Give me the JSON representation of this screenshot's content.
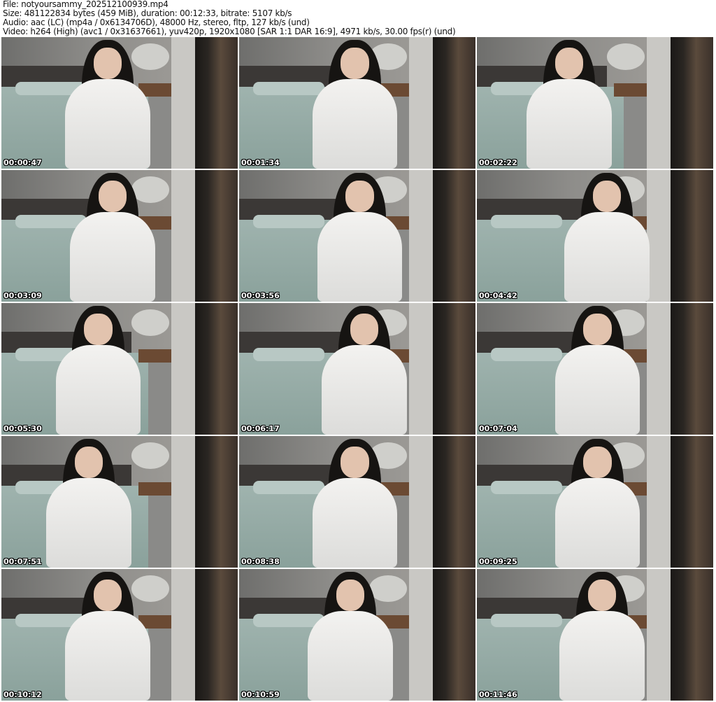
{
  "header": {
    "file": "File: notyoursammy_202512100939.mp4",
    "size": "Size: 481122834 bytes (459 MiB), duration: 00:12:33, bitrate: 5107 kb/s",
    "audio": "Audio: aac (LC) (mp4a / 0x6134706D), 48000 Hz, stereo, fltp, 127 kb/s (und)",
    "video": "Video: h264 (High) (avc1 / 0x31637661), yuv420p, 1920x1080 [SAR 1:1 DAR 16:9], 4971 kb/s, 30.00 fps(r) (und)"
  },
  "thumbnails": [
    {
      "timestamp": "00:00:47"
    },
    {
      "timestamp": "00:01:34"
    },
    {
      "timestamp": "00:02:22"
    },
    {
      "timestamp": "00:03:09"
    },
    {
      "timestamp": "00:03:56"
    },
    {
      "timestamp": "00:04:42"
    },
    {
      "timestamp": "00:05:30"
    },
    {
      "timestamp": "00:06:17"
    },
    {
      "timestamp": "00:07:04"
    },
    {
      "timestamp": "00:07:51"
    },
    {
      "timestamp": "00:08:38"
    },
    {
      "timestamp": "00:09:25"
    },
    {
      "timestamp": "00:10:12"
    },
    {
      "timestamp": "00:10:59"
    },
    {
      "timestamp": "00:11:46"
    }
  ]
}
